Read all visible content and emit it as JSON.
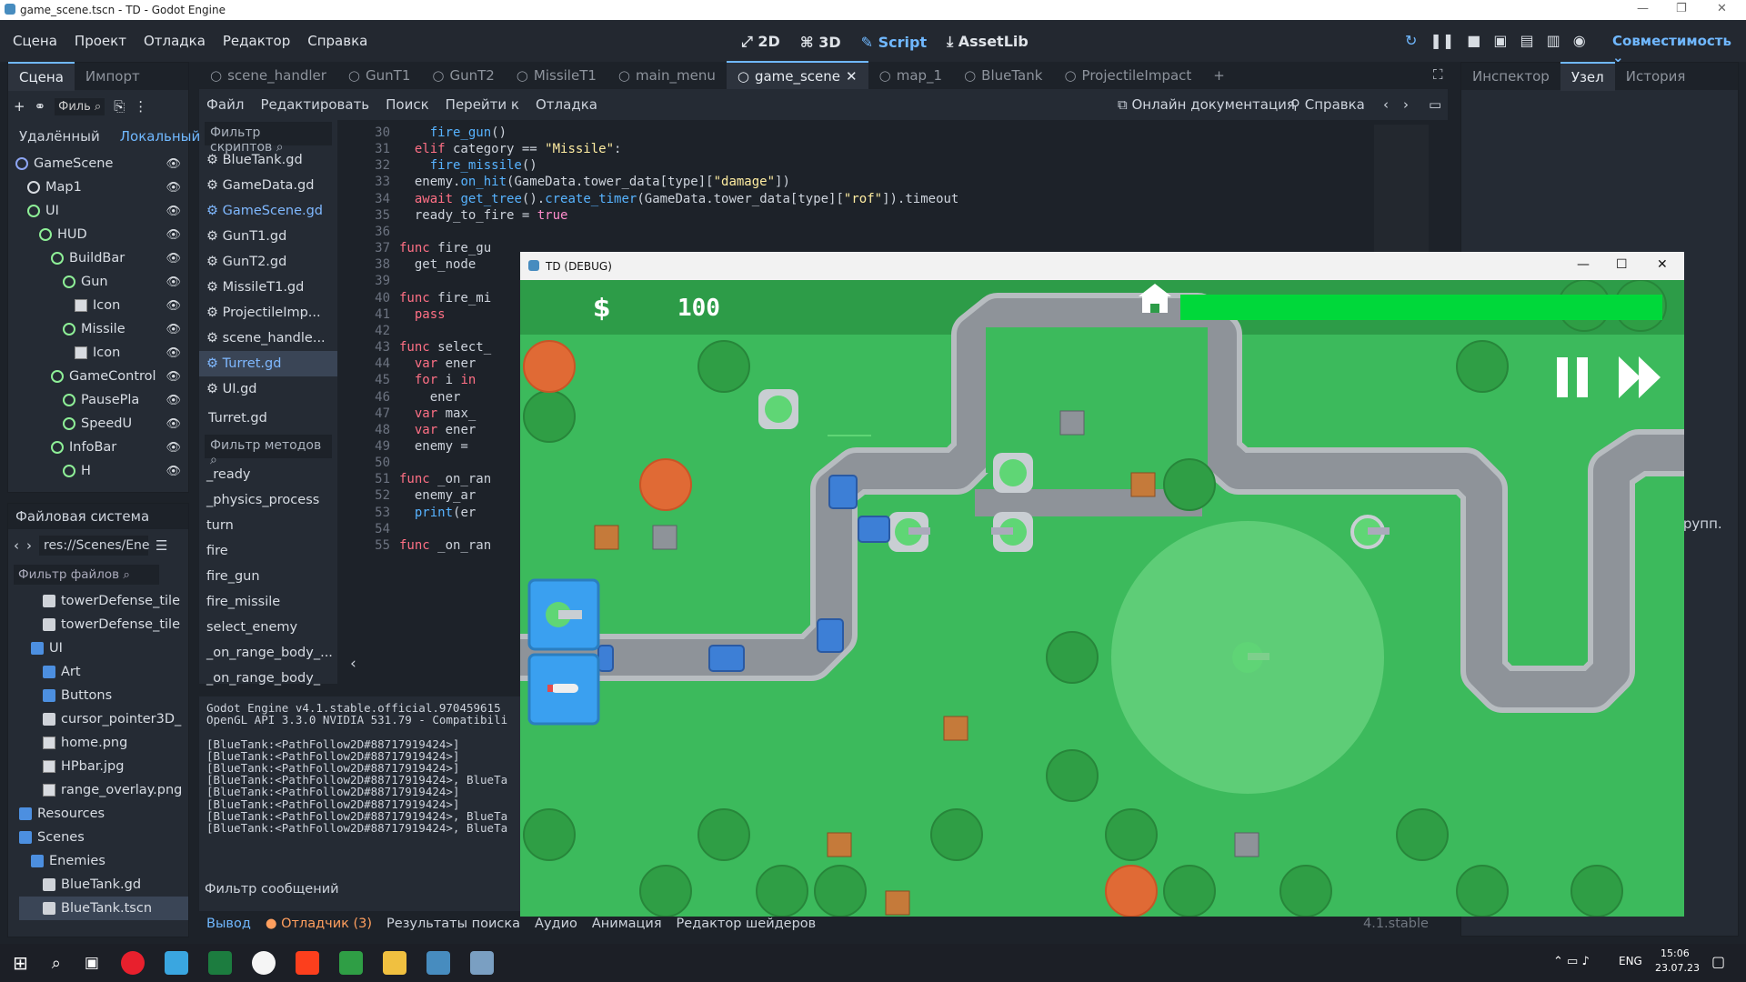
{
  "window": {
    "title": "game_scene.tscn - TD - Godot Engine"
  },
  "menu": [
    "Сцена",
    "Проект",
    "Отладка",
    "Редактор",
    "Справка"
  ],
  "modes": [
    "2D",
    "3D",
    "Script",
    "AssetLib"
  ],
  "renderer": "Совместимость",
  "scene_dock": {
    "tabs": [
      "Сцена",
      "Импорт"
    ],
    "filter": "Филь",
    "sub_tabs": [
      "Удалённый",
      "Локальный"
    ],
    "tree": [
      {
        "label": "GameScene",
        "indent": 0,
        "type": "n2d"
      },
      {
        "label": "Map1",
        "indent": 1,
        "type": "node"
      },
      {
        "label": "UI",
        "indent": 1,
        "type": "ctrl"
      },
      {
        "label": "HUD",
        "indent": 2,
        "type": "ctrl"
      },
      {
        "label": "BuildBar",
        "indent": 3,
        "type": "ctrl"
      },
      {
        "label": "Gun",
        "indent": 4,
        "type": "ctrl"
      },
      {
        "label": "Icon",
        "indent": 5,
        "type": "img"
      },
      {
        "label": "Missile",
        "indent": 4,
        "type": "ctrl"
      },
      {
        "label": "Icon",
        "indent": 5,
        "type": "img"
      },
      {
        "label": "GameControl",
        "indent": 3,
        "type": "ctrl"
      },
      {
        "label": "PausePla",
        "indent": 4,
        "type": "ctrl"
      },
      {
        "label": "SpeedU",
        "indent": 4,
        "type": "ctrl"
      },
      {
        "label": "InfoBar",
        "indent": 3,
        "type": "ctrl"
      },
      {
        "label": "H",
        "indent": 4,
        "type": "ctrl"
      }
    ]
  },
  "filesystem": {
    "title": "Файловая система",
    "path": "res://Scenes/Ene",
    "filter": "Фильтр файлов",
    "items": [
      {
        "label": "towerDefense_tile",
        "indent": 2,
        "type": "file"
      },
      {
        "label": "towerDefense_tile",
        "indent": 2,
        "type": "file"
      },
      {
        "label": "UI",
        "indent": 1,
        "type": "folder"
      },
      {
        "label": "Art",
        "indent": 2,
        "type": "folder"
      },
      {
        "label": "Buttons",
        "indent": 2,
        "type": "folder"
      },
      {
        "label": "cursor_pointer3D_",
        "indent": 2,
        "type": "file"
      },
      {
        "label": "home.png",
        "indent": 2,
        "type": "img"
      },
      {
        "label": "HPbar.jpg",
        "indent": 2,
        "type": "img"
      },
      {
        "label": "range_overlay.png",
        "indent": 2,
        "type": "img"
      },
      {
        "label": "Resources",
        "indent": 0,
        "type": "folder"
      },
      {
        "label": "Scenes",
        "indent": 0,
        "type": "folder"
      },
      {
        "label": "Enemies",
        "indent": 1,
        "type": "folder"
      },
      {
        "label": "BlueTank.gd",
        "indent": 2,
        "type": "file"
      },
      {
        "label": "BlueTank.tscn",
        "indent": 2,
        "type": "file"
      }
    ]
  },
  "editor_tabs": [
    "scene_handler",
    "GunT1",
    "GunT2",
    "MissileT1",
    "main_menu",
    "game_scene",
    "map_1",
    "BlueTank",
    "ProjectileImpact"
  ],
  "script_menu": [
    "Файл",
    "Редактировать",
    "Поиск",
    "Перейти к",
    "Отладка"
  ],
  "online_docs": "Онлайн документация",
  "help": "Справка",
  "script_filter": "Фильтр скриптов",
  "scripts": [
    "BlueTank.gd",
    "GameData.gd",
    "GameScene.gd",
    "GunT1.gd",
    "GunT2.gd",
    "MissileT1.gd",
    "ProjectileImp...",
    "scene_handle...",
    "Turret.gd",
    "UI.gd"
  ],
  "current_script": "Turret.gd",
  "method_filter": "Фильтр методов",
  "methods": [
    "_ready",
    "_physics_process",
    "turn",
    "fire",
    "fire_gun",
    "fire_missile",
    "select_enemy",
    "_on_range_body_...",
    "_on_range_body_"
  ],
  "code_lines": [
    {
      "n": "30",
      "t": "\t\tfire_gun()"
    },
    {
      "n": "31",
      "t": "\telif category == \"Missile\":"
    },
    {
      "n": "32",
      "t": "\t\tfire_missile()"
    },
    {
      "n": "33",
      "t": "\tenemy.on_hit(GameData.tower_data[type][\"damage\"])"
    },
    {
      "n": "34",
      "t": "\tawait get_tree().create_timer(GameData.tower_data[type][\"rof\"]).timeout"
    },
    {
      "n": "35",
      "t": "\tready_to_fire = true"
    },
    {
      "n": "36",
      "t": ""
    },
    {
      "n": "37",
      "t": "func fire_gu"
    },
    {
      "n": "38",
      "t": "\tget_node"
    },
    {
      "n": "39",
      "t": ""
    },
    {
      "n": "40",
      "t": "func fire_mi"
    },
    {
      "n": "41",
      "t": "\tpass"
    },
    {
      "n": "42",
      "t": ""
    },
    {
      "n": "43",
      "t": "func select_"
    },
    {
      "n": "44",
      "t": "\tvar ener"
    },
    {
      "n": "45",
      "t": "\tfor i in"
    },
    {
      "n": "46",
      "t": "\t\tener"
    },
    {
      "n": "47",
      "t": "\tvar max_"
    },
    {
      "n": "48",
      "t": "\tvar ener"
    },
    {
      "n": "49",
      "t": "\tenemy ="
    },
    {
      "n": "50",
      "t": ""
    },
    {
      "n": "51",
      "t": "func _on_ran"
    },
    {
      "n": "52",
      "t": "\tenemy_ar"
    },
    {
      "n": "53",
      "t": "\tprint(er"
    },
    {
      "n": "54",
      "t": ""
    },
    {
      "n": "55",
      "t": "func _on_ran"
    }
  ],
  "output_lines": [
    "Godot Engine v4.1.stable.official.970459615",
    "OpenGL API 3.3.0 NVIDIA 531.79 - Compatibili",
    "",
    "[BlueTank:<PathFollow2D#88717919424>]",
    "[BlueTank:<PathFollow2D#88717919424>]",
    "[BlueTank:<PathFollow2D#88717919424>]",
    "[BlueTank:<PathFollow2D#88717919424>, BlueTa",
    "[BlueTank:<PathFollow2D#88717919424>]",
    "[BlueTank:<PathFollow2D#88717919424>]",
    "[BlueTank:<PathFollow2D#88717919424>, BlueTa",
    "[BlueTank:<PathFollow2D#88717919424>, BlueTa"
  ],
  "message_filter": "Фильтр сообщений",
  "bottom_tabs": [
    "Вывод",
    "Отладчик (3)",
    "Результаты поиска",
    "Аудио",
    "Анимация",
    "Редактор шейдеров"
  ],
  "version": "4.1.stable",
  "inspector_tabs": [
    "Инспектор",
    "Узел",
    "История"
  ],
  "inspector_text": "групп.",
  "game_window": {
    "title": "TD (DEBUG)",
    "money": "100",
    "health_fraction": 1.0
  },
  "taskbar": {
    "lang": "ENG",
    "time": "15:06",
    "date": "23.07.23"
  }
}
